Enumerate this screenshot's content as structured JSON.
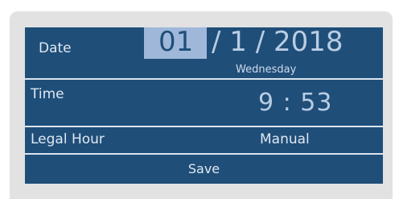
{
  "date": {
    "label": "Date",
    "day": "01",
    "rest": "/ 1 / 2018",
    "weekday": "Wednesday"
  },
  "time": {
    "label": "Time",
    "value": "9 : 53"
  },
  "legal_hour": {
    "label": "Legal Hour",
    "value": "Manual"
  },
  "save": {
    "label": "Save"
  },
  "colors": {
    "row_background": "#1f4e79",
    "day_highlight": "#9fb8da",
    "frame": "#e2e2e2"
  }
}
